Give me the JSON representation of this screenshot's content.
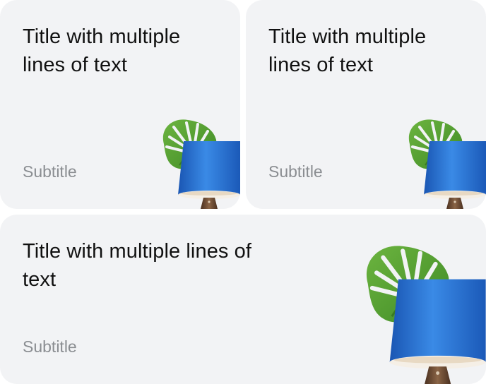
{
  "cards": [
    {
      "title": "Title with multiple lines of text",
      "subtitle": "Subtitle",
      "image_icon": "plant-and-lamp-illustration"
    },
    {
      "title": "Title with multiple lines of text",
      "subtitle": "Subtitle",
      "image_icon": "plant-and-lamp-illustration"
    },
    {
      "title": "Title with multiple lines of text",
      "subtitle": "Subtitle",
      "image_icon": "plant-and-lamp-illustration"
    }
  ],
  "colors": {
    "card_background": "#f2f3f5",
    "title_text": "#111111",
    "subtitle_text": "#8a8d91",
    "leaf_green": "#4e9a2f",
    "lamp_blue": "#1f6fd0",
    "lamp_stand": "#6b4a36"
  }
}
